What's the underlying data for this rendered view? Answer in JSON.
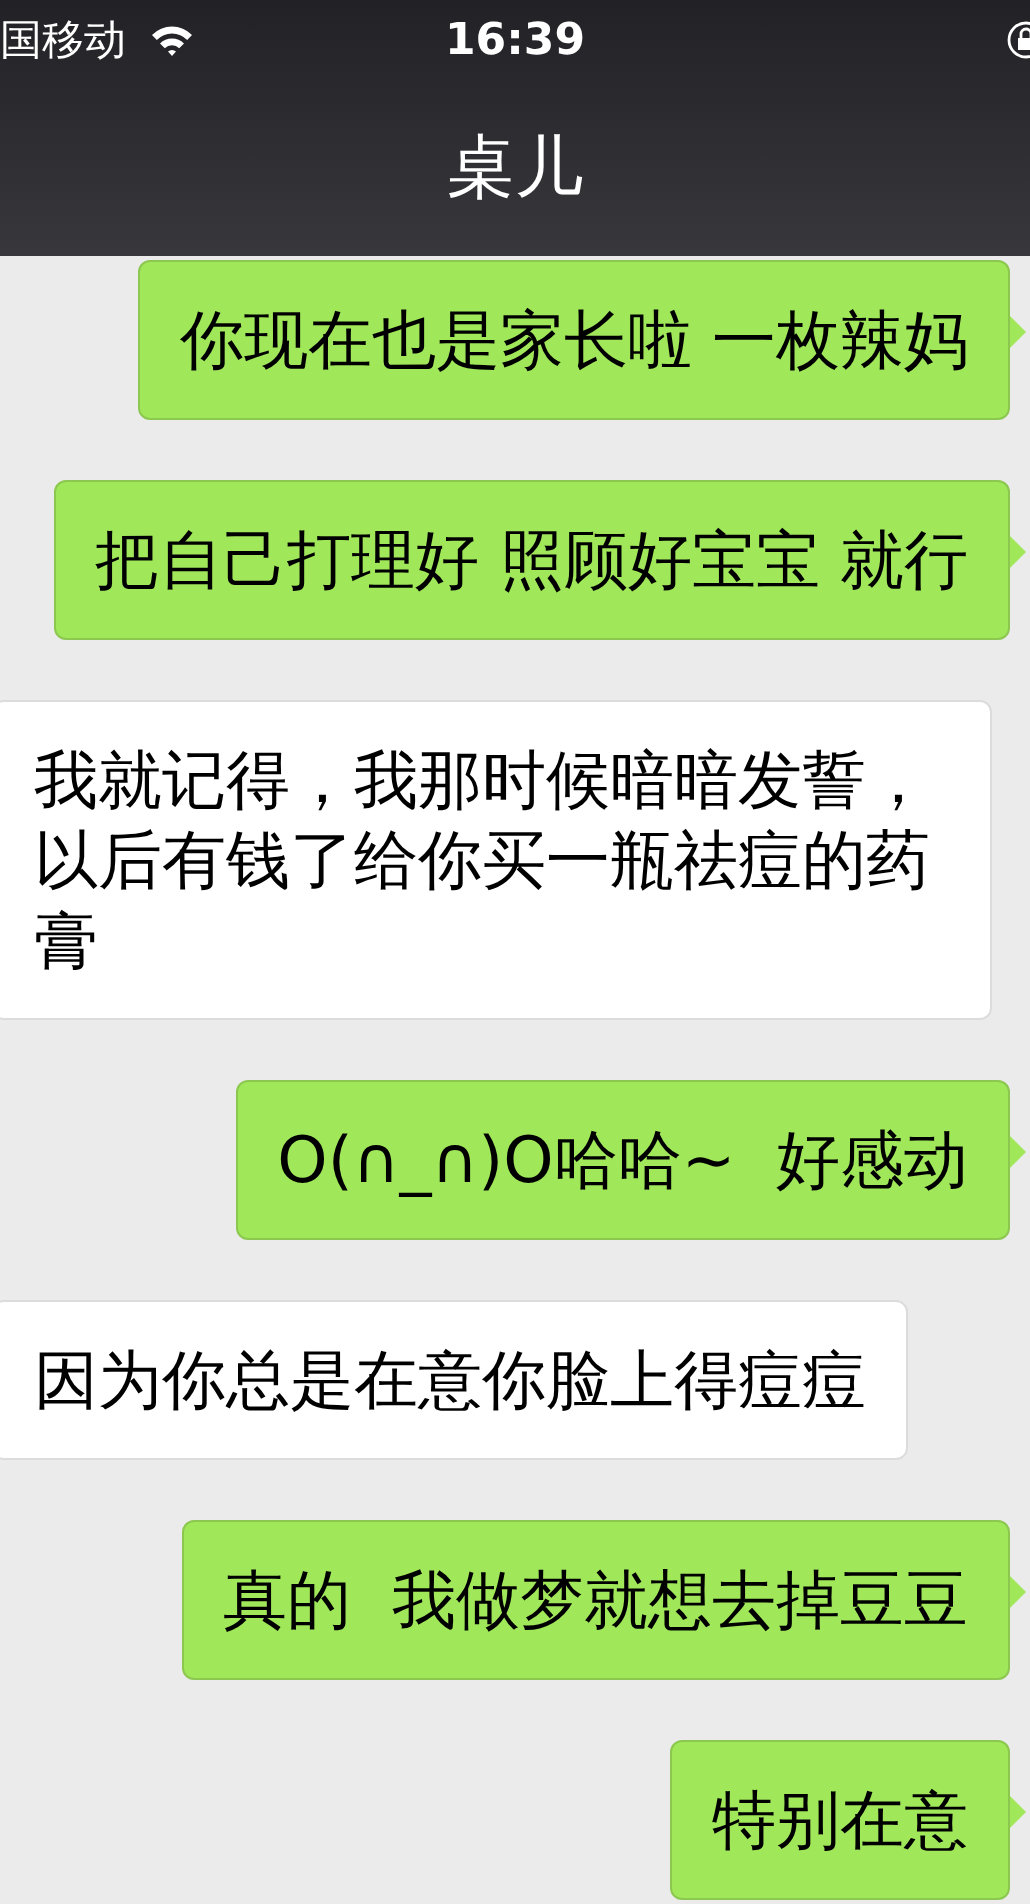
{
  "status_bar": {
    "carrier": "国移动",
    "time": "16:39"
  },
  "header": {
    "title": "桌儿"
  },
  "messages": [
    {
      "kind": "sent",
      "text": "你现在也是家长啦 一枚辣妈"
    },
    {
      "kind": "sent",
      "text": "把自己打理好 照顾好宝宝 就行"
    },
    {
      "kind": "received",
      "text": "我就记得，我那时候暗暗发誓，以后有钱了给你买一瓶祛痘的药膏"
    },
    {
      "kind": "sent",
      "text": "O(∩_∩)O哈哈~  好感动"
    },
    {
      "kind": "received",
      "text": "因为你总是在意你脸上得痘痘"
    },
    {
      "kind": "sent",
      "text": "真的  我做梦就想去掉豆豆"
    },
    {
      "kind": "sent",
      "text": "特别在意"
    }
  ]
}
